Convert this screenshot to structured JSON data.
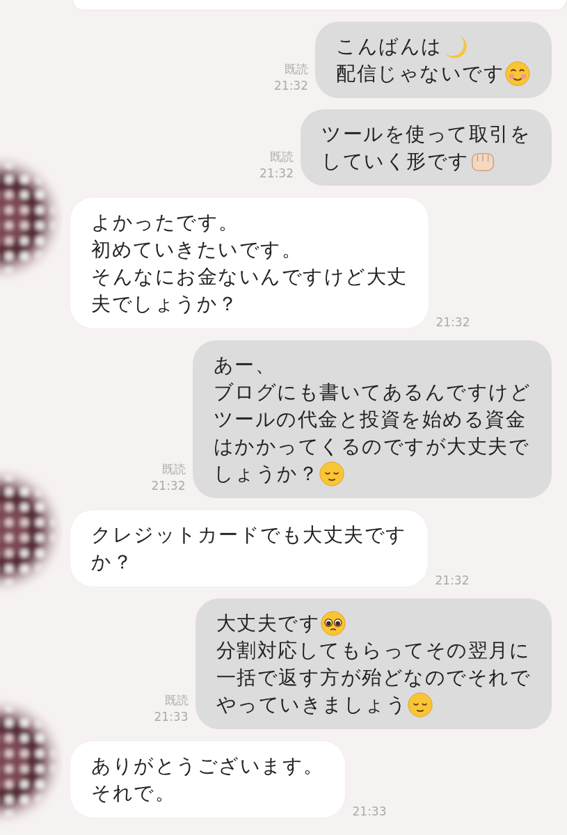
{
  "messages": [
    {
      "kind": "partial"
    },
    {
      "kind": "sent",
      "read_label": "既読",
      "time": "21:32",
      "lines": [
        {
          "text": "こんばんは",
          "emoji": {
            "kind": "moon"
          }
        },
        {
          "text": "配信じゃないです",
          "emoji": {
            "kind": "smiling"
          }
        }
      ]
    },
    {
      "kind": "sent",
      "read_label": "既読",
      "time": "21:32",
      "lines": [
        {
          "text": "ツールを使って取引を"
        },
        {
          "text": "していく形です",
          "emoji": {
            "kind": "fist"
          }
        }
      ]
    },
    {
      "kind": "received",
      "time": "21:32",
      "lines": [
        {
          "text": "よかったです。"
        },
        {
          "text": "初めていきたいです。"
        },
        {
          "text": "そんなにお金ないんですけど大丈"
        },
        {
          "text": "夫でしょうか？"
        }
      ]
    },
    {
      "kind": "sent",
      "read_label": "既読",
      "time": "21:32",
      "lines": [
        {
          "text": "あー、"
        },
        {
          "text": "ブログにも書いてあるんですけど"
        },
        {
          "text": "ツールの代金と投資を始める資金"
        },
        {
          "text": "はかかってくるのですが大丈夫で"
        },
        {
          "text": "しょうか？",
          "emoji": {
            "kind": "relieved"
          }
        }
      ]
    },
    {
      "kind": "received",
      "time": "21:32",
      "lines": [
        {
          "text": "クレジットカードでも大丈夫です"
        },
        {
          "text": "か？"
        }
      ]
    },
    {
      "kind": "sent",
      "read_label": "既読",
      "time": "21:33",
      "lines": [
        {
          "text": "大丈夫です",
          "emoji": {
            "kind": "pleading"
          }
        },
        {
          "text": "分割対応してもらってその翌月に"
        },
        {
          "text": "一括で返す方が殆どなのでそれで"
        },
        {
          "text": "やっていきましょう",
          "emoji": {
            "kind": "relieved"
          }
        }
      ]
    },
    {
      "kind": "received",
      "time": "21:33",
      "lines": [
        {
          "text": "ありがとうございます。"
        },
        {
          "text": "それで。"
        }
      ]
    }
  ]
}
